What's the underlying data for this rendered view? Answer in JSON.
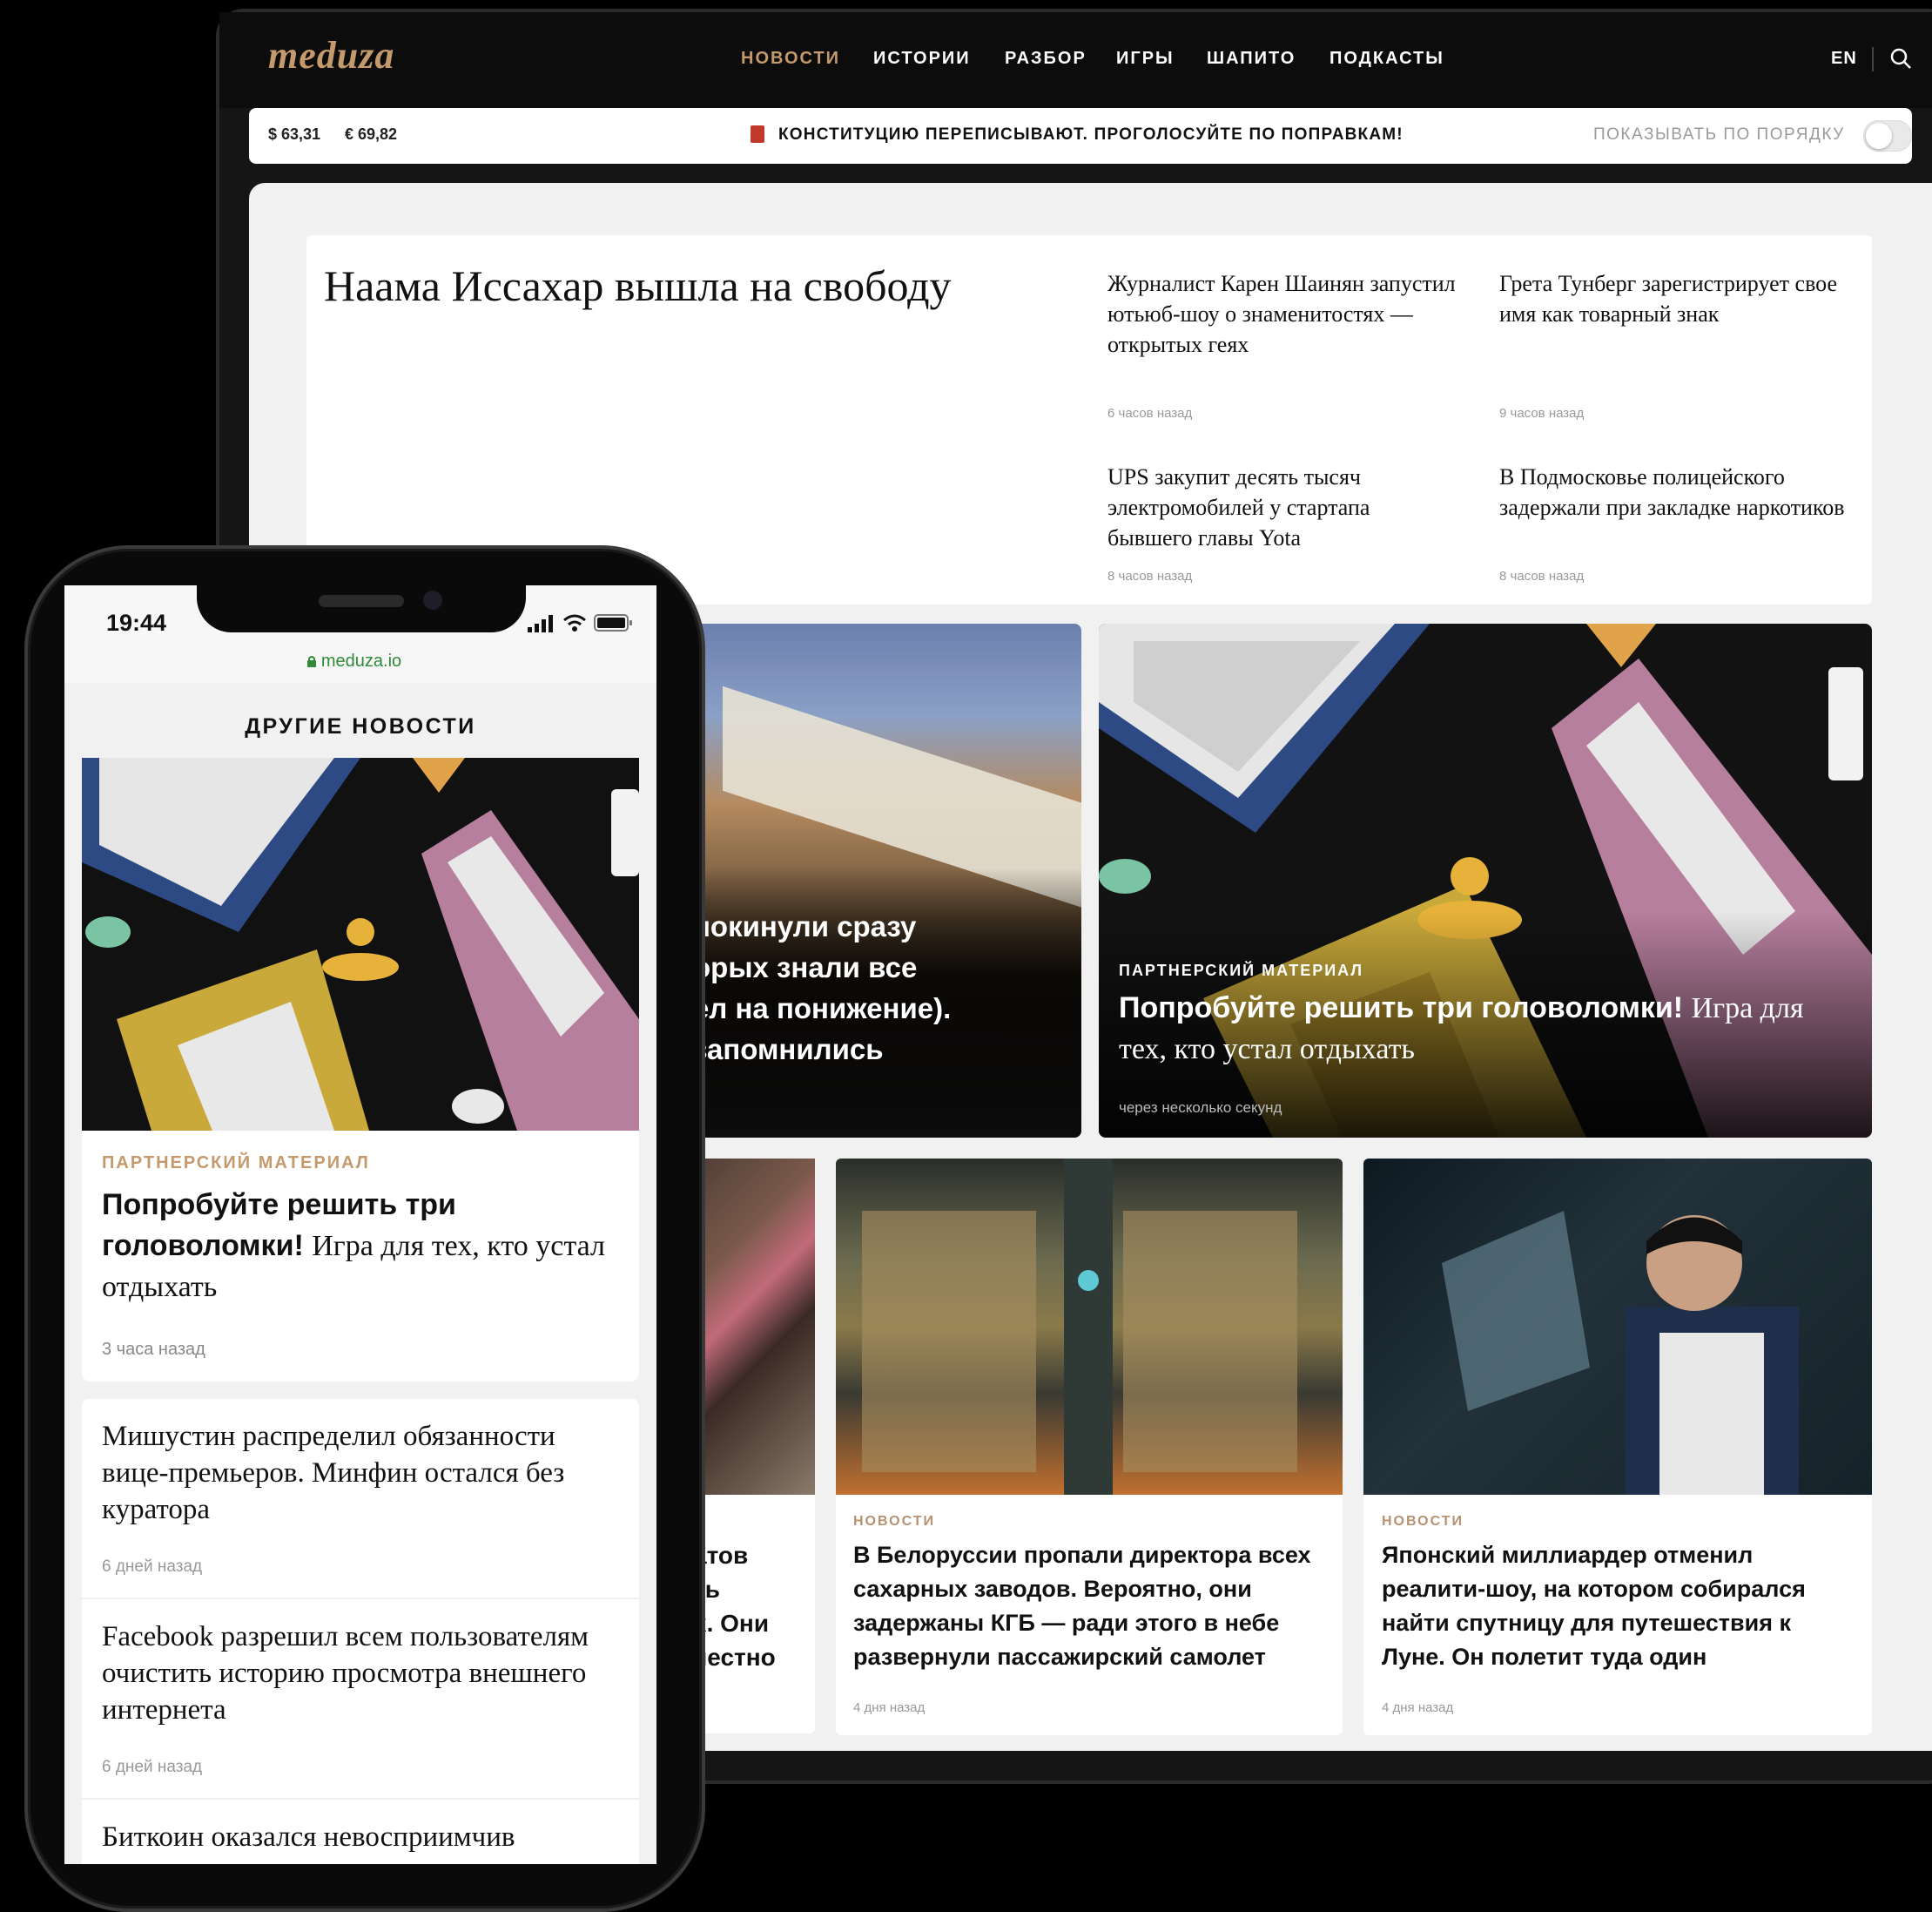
{
  "desktop": {
    "logo": "meduza",
    "nav": [
      {
        "label": "НОВОСТИ",
        "active": true
      },
      {
        "label": "ИСТОРИИ",
        "active": false
      },
      {
        "label": "РАЗБОР",
        "active": false
      },
      {
        "label": "ИГРЫ",
        "active": false
      },
      {
        "label": "ШАПИТО",
        "active": false
      },
      {
        "label": "ПОДКАСТЫ",
        "active": false
      }
    ],
    "lang": "EN",
    "icons": {
      "search": "search-icon",
      "promo": "book-icon"
    },
    "currency": {
      "usd": "$ 63,31",
      "eur": "€ 69,82"
    },
    "promo": "КОНСТИТУЦИЮ ПЕРЕПИСЫВАЮТ. ПРОГОЛОСУЙТЕ ПО ПОПРАВКАМ!",
    "order_label": "ПОКАЗЫВАТЬ ПО ПОРЯДКУ",
    "order_toggle_on": false,
    "main_headline": "Наама Иссахар вышла на свободу",
    "side_news": [
      {
        "title": "Журналист Карен Шаинян запустил ютьюб-шоу о знаменитостях — открытых геях",
        "time": "6 часов назад"
      },
      {
        "title": "Грета Тунберг зарегистрирует свое имя как товарный знак",
        "time": "9 часов назад"
      },
      {
        "title": "UPS закупит десять тысяч электромобилей у стартапа бывшего главы Yota",
        "time": "8 часов назад"
      },
      {
        "title": "В Подмосковье полицейского задержали при закладке наркотиков",
        "time": "8 часов назад"
      }
    ],
    "gov_card": {
      "lines": [
        "покинули сразу",
        "орых знали все",
        "ел на понижение).",
        "запомнились"
      ]
    },
    "puzzle_card": {
      "category": "ПАРТНЕРСКИЙ МАТЕРИАЛ",
      "title_bold": "Попробуйте решить три головоломки!",
      "title_rest": "Игра для тех, кто устал отдыхать",
      "time": "через несколько секунд"
    },
    "run_card": {
      "lines": [
        "атов",
        "ть",
        "х. Они",
        "честно"
      ]
    },
    "news_cards": [
      {
        "category": "НОВОСТИ",
        "title": "В Белоруссии пропали директора всех сахарных заводов. Вероятно, они задержаны КГБ — ради этого в небе развернули пассажирский самолет",
        "time": "4 дня назад"
      },
      {
        "category": "НОВОСТИ",
        "title": "Японский миллиардер отменил реалити-шоу, на котором собирался найти спутницу для путешествия к Луне. Он полетит туда один",
        "time": "4 дня назад"
      }
    ]
  },
  "phone": {
    "time": "19:44",
    "url": "meduza.io",
    "section": "ДРУГИЕ НОВОСТИ",
    "card": {
      "category": "ПАРТНЕРСКИЙ МАТЕРИАЛ",
      "title_bold": "Попробуйте решить три головоломки!",
      "title_rest": "Игра для тех, кто устал отдыхать",
      "time": "3 часа назад"
    },
    "list": [
      {
        "title": "Мишустин распределил обязанности вице-премьеров. Минфин остался без куратора",
        "time": "6 дней назад"
      },
      {
        "title": "Facebook разрешил всем пользователям очистить историю просмотра внешнего интернета",
        "time": "6 дней назад"
      },
      {
        "title": "Биткоин оказался невосприимчив",
        "time": ""
      }
    ]
  },
  "colors": {
    "accent": "#c49a6c",
    "category": "#b79270",
    "link_green": "#2f8a3a"
  }
}
